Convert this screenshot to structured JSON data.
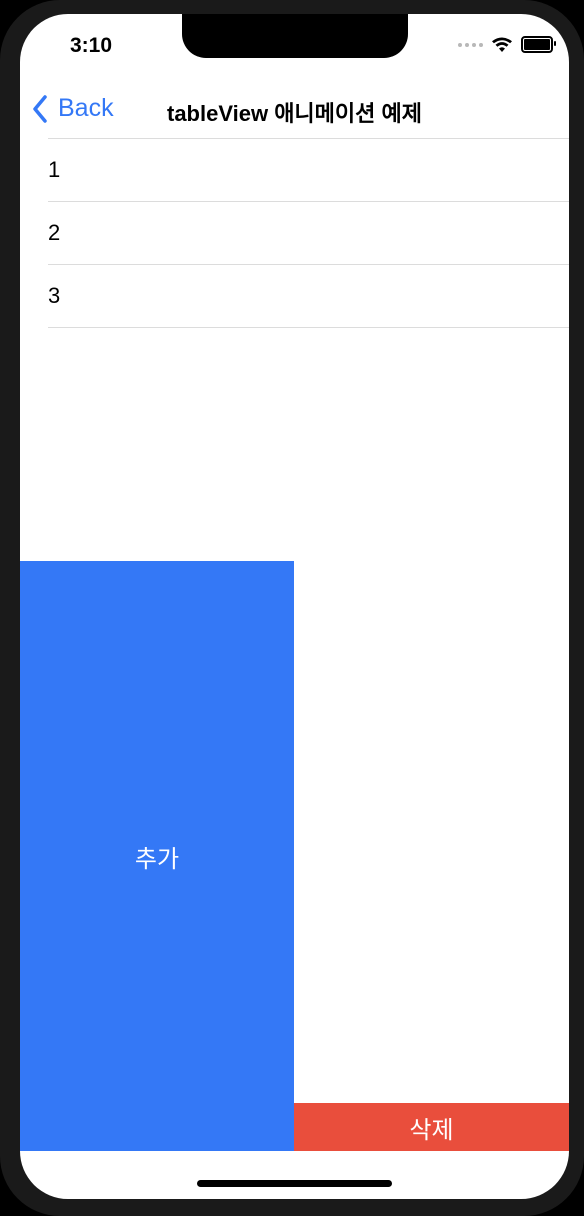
{
  "status_bar": {
    "time": "3:10"
  },
  "nav": {
    "back_label": "Back",
    "title": "tableView 애니메이션 예제"
  },
  "table": {
    "rows": [
      "1",
      "2",
      "3"
    ]
  },
  "buttons": {
    "add_label": "추가",
    "delete_label": "삭제"
  },
  "colors": {
    "accent": "#3478f6",
    "add_button": "#3478f6",
    "delete_button": "#e94e3c"
  },
  "icons": [
    "chevron-left-icon",
    "cellular-signal-icon",
    "wifi-icon",
    "battery-icon"
  ]
}
